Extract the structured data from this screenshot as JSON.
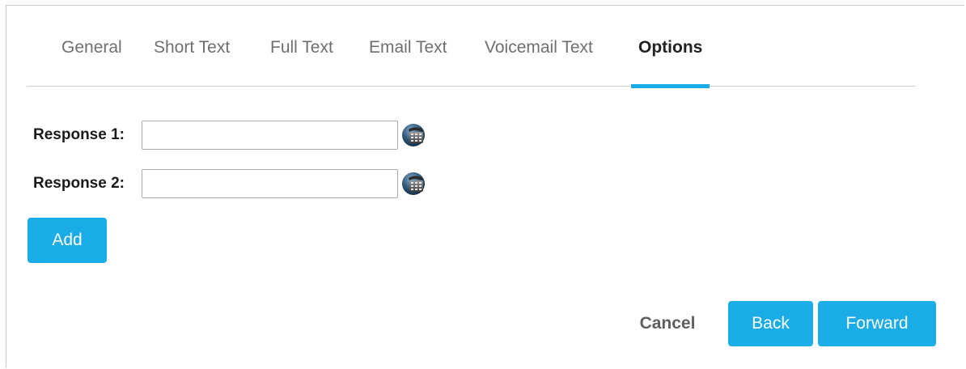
{
  "tabs": [
    {
      "label": "General"
    },
    {
      "label": "Short Text"
    },
    {
      "label": "Full Text"
    },
    {
      "label": "Email Text"
    },
    {
      "label": "Voicemail Text"
    },
    {
      "label": "Options",
      "active": true
    }
  ],
  "form": {
    "responses": [
      {
        "label": "Response 1:",
        "value": "",
        "icon": "phone-icon"
      },
      {
        "label": "Response 2:",
        "value": "",
        "icon": "phone-icon"
      }
    ]
  },
  "actions": {
    "add_label": "Add",
    "cancel_label": "Cancel",
    "back_label": "Back",
    "forward_label": "Forward"
  },
  "colors": {
    "accent": "#1aace6",
    "active_tab_text": "#222222",
    "inactive_tab_text": "#6f6f6f"
  }
}
